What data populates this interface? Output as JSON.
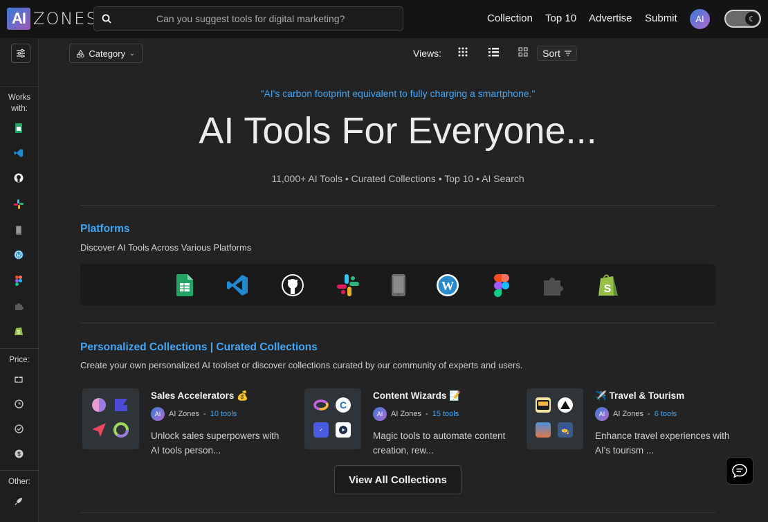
{
  "header": {
    "logo_mark": "AI",
    "logo_text": "ZONES",
    "search_placeholder": "Can you suggest tools for digital marketing?",
    "nav": [
      "Collection",
      "Top 10",
      "Advertise",
      "Submit"
    ],
    "avatar_text": "AI"
  },
  "sidebar": {
    "works_with_label": "Works with:",
    "works_with_icons": [
      "google-sheets-icon",
      "vscode-icon",
      "github-icon",
      "slack-icon",
      "mobile-icon",
      "wordpress-icon",
      "figma-icon",
      "plugin-icon",
      "shopify-icon"
    ],
    "price_label": "Price:",
    "price_icons": [
      "gift-icon",
      "clock-icon",
      "check-circle-icon",
      "dollar-icon"
    ],
    "other_label": "Other:",
    "other_icons": [
      "rocket-icon"
    ]
  },
  "toolbar": {
    "category_label": "Category",
    "views_label": "Views:",
    "sort_label": "Sort"
  },
  "hero": {
    "quote": "\"AI's carbon footprint equivalent to fully charging a smartphone.\"",
    "title": "AI Tools For Everyone...",
    "subtitle": "11,000+ AI Tools • Curated Collections • Top 10 • AI Search"
  },
  "platforms": {
    "title": "Platforms",
    "description": "Discover AI Tools Across Various Platforms",
    "icons": [
      "google-sheets-icon",
      "vscode-icon",
      "github-icon",
      "slack-icon",
      "mobile-icon",
      "wordpress-icon",
      "figma-icon",
      "plugin-icon",
      "shopify-icon"
    ]
  },
  "collections": {
    "title": "Personalized Collections | Curated Collections",
    "description": "Create your own personalized AI toolset or discover collections curated by our community of experts and users.",
    "cards": [
      {
        "title": "Sales Accelerators 💰",
        "author": "AI Zones",
        "separator": "-",
        "count": "10 tools",
        "description": "Unlock sales superpowers with AI tools person..."
      },
      {
        "title": "Content Wizards 📝",
        "author": "AI Zones",
        "separator": "-",
        "count": "15 tools",
        "description": "Magic tools to automate content creation, rew..."
      },
      {
        "title": "✈️ Travel & Tourism",
        "author": "AI Zones",
        "separator": "-",
        "count": "6 tools",
        "description": "Enhance travel experiences with AI's tourism ..."
      }
    ],
    "view_all_label": "View All Collections"
  },
  "colors": {
    "accent": "#42a5f5",
    "background": "#232323",
    "topbar": "#141414"
  }
}
